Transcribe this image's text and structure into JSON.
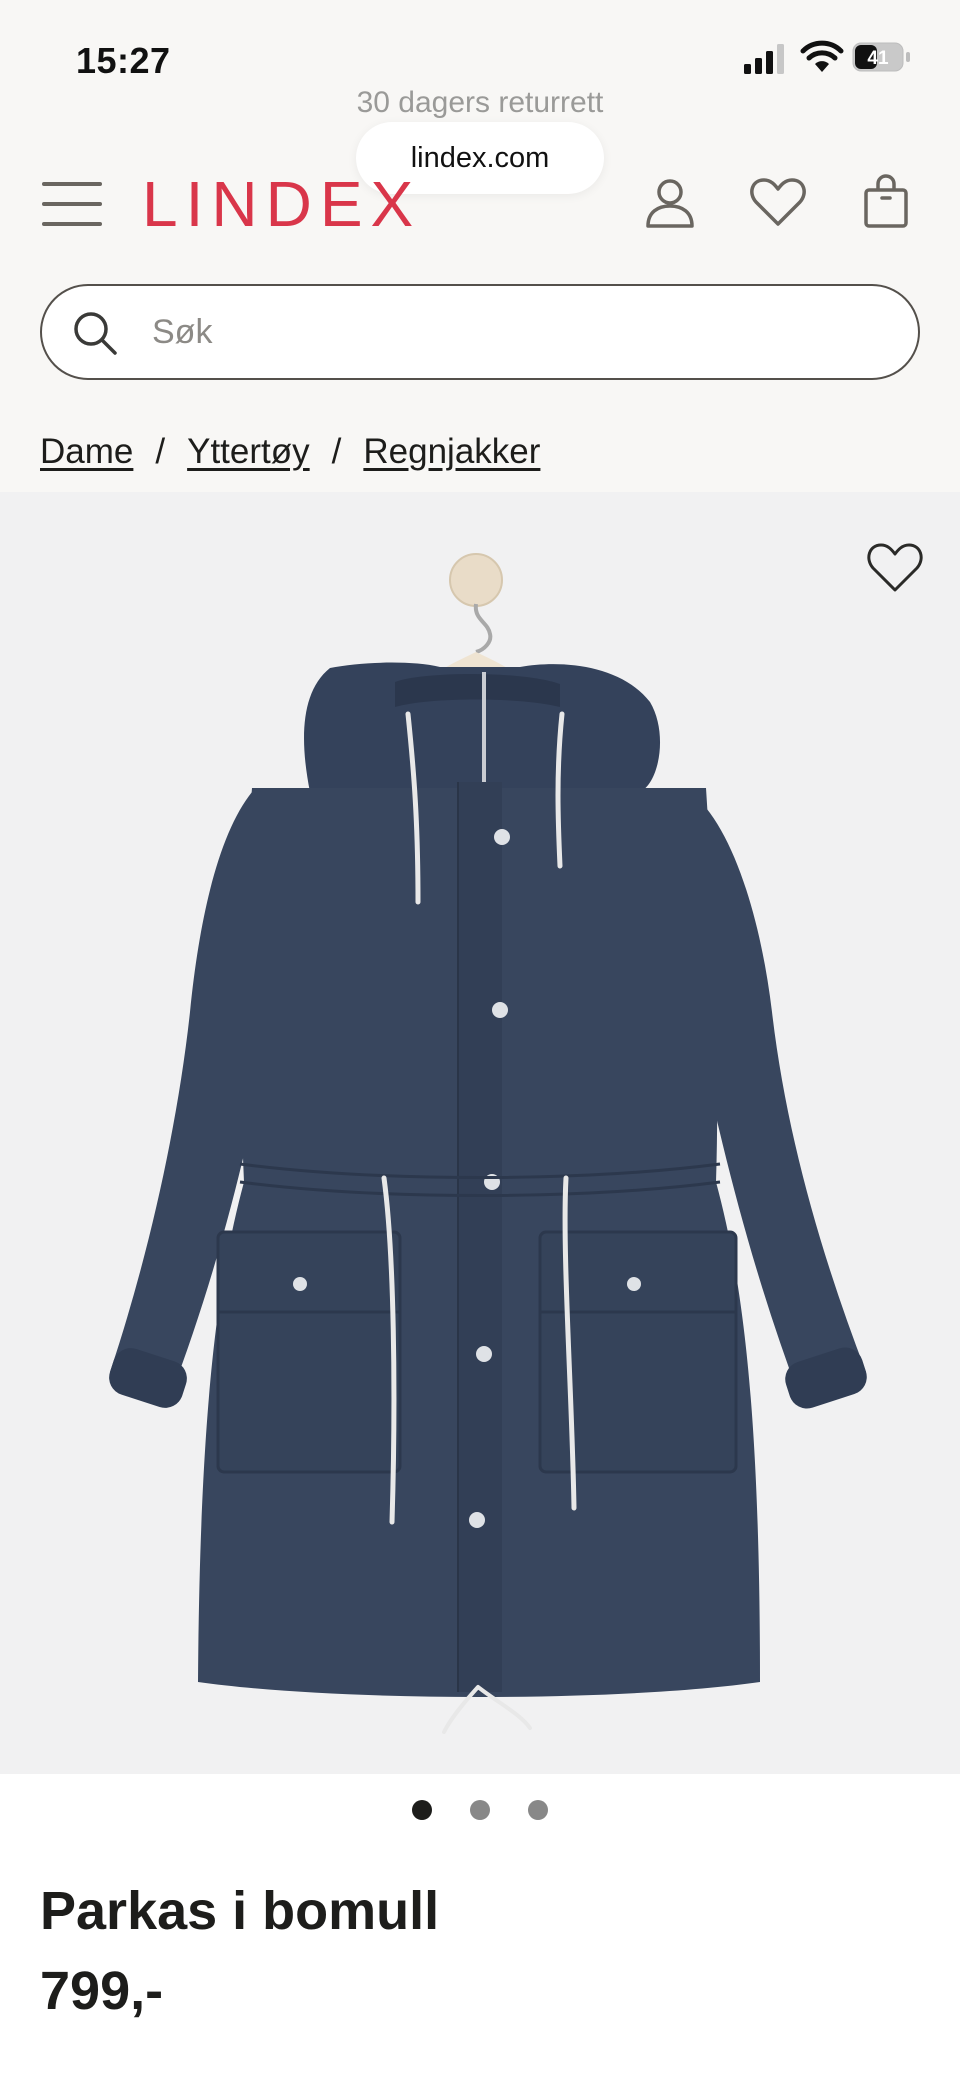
{
  "status_bar": {
    "time": "15:27",
    "battery_level": "41"
  },
  "browser": {
    "url": "lindex.com"
  },
  "promo_banner": "30 dagers returrett",
  "header": {
    "logo": "LINDEX",
    "icons": [
      "menu-icon",
      "account-icon",
      "wishlist-icon",
      "bag-icon"
    ]
  },
  "search": {
    "placeholder": "Søk",
    "value": ""
  },
  "breadcrumb": {
    "items": [
      "Dame",
      "Yttertøy",
      "Regnjakker"
    ],
    "separator": "/"
  },
  "product": {
    "image_alt": "Navy cotton parka on hanger",
    "gallery_count": 3,
    "gallery_active_index": 0,
    "name": "Parkas i bomull",
    "price": "799,-"
  },
  "colors": {
    "brand": "#d9364a",
    "text": "#1d1d1b",
    "header_bg": "#f8f7f5",
    "image_bg": "#f1f1f2",
    "coat": "#38465e"
  }
}
